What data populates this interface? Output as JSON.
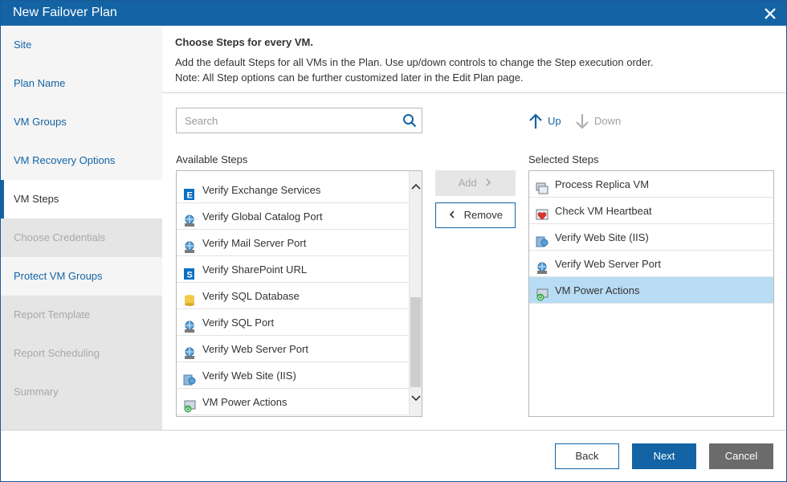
{
  "window": {
    "title": "New Failover Plan"
  },
  "nav": [
    {
      "label": "Site",
      "state": "done"
    },
    {
      "label": "Plan Name",
      "state": "done"
    },
    {
      "label": "VM Groups",
      "state": "done"
    },
    {
      "label": "VM Recovery Options",
      "state": "done"
    },
    {
      "label": "VM Steps",
      "state": "active"
    },
    {
      "label": "Choose Credentials",
      "state": "disabled"
    },
    {
      "label": "Protect VM Groups",
      "state": "done"
    },
    {
      "label": "Report Template",
      "state": "disabled"
    },
    {
      "label": "Report Scheduling",
      "state": "disabled"
    },
    {
      "label": "Summary",
      "state": "disabled"
    }
  ],
  "header": {
    "title": "Choose Steps for every VM.",
    "line1": "Add the default Steps for all VMs in the Plan. Use up/down controls to change the Step execution order.",
    "line2": "Note: All Step options can be further customized later in the Edit Plan page."
  },
  "search": {
    "placeholder": "Search",
    "value": ""
  },
  "available": {
    "label": "Available Steps",
    "items": [
      {
        "label": "Verify Exchange Services",
        "icon": "exchange-icon"
      },
      {
        "label": "Verify Global Catalog Port",
        "icon": "globe-port-icon"
      },
      {
        "label": "Verify Mail Server Port",
        "icon": "globe-port-icon"
      },
      {
        "label": "Verify SharePoint URL",
        "icon": "sharepoint-icon"
      },
      {
        "label": "Verify SQL Database",
        "icon": "database-icon"
      },
      {
        "label": "Verify SQL Port",
        "icon": "globe-port-icon"
      },
      {
        "label": "Verify Web Server Port",
        "icon": "globe-port-icon"
      },
      {
        "label": "Verify Web Site (IIS)",
        "icon": "iis-icon"
      },
      {
        "label": "VM Power Actions",
        "icon": "vm-power-icon"
      }
    ]
  },
  "actions": {
    "add": "Add",
    "remove": "Remove",
    "up": "Up",
    "down": "Down"
  },
  "selected": {
    "label": "Selected Steps",
    "items": [
      {
        "label": "Process Replica VM",
        "icon": "replica-icon"
      },
      {
        "label": "Check VM Heartbeat",
        "icon": "heartbeat-icon"
      },
      {
        "label": "Verify Web Site (IIS)",
        "icon": "iis-icon"
      },
      {
        "label": "Verify Web Server Port",
        "icon": "globe-port-icon"
      },
      {
        "label": "VM Power Actions",
        "icon": "vm-power-icon",
        "selected": true
      }
    ]
  },
  "footer": {
    "back": "Back",
    "next": "Next",
    "cancel": "Cancel"
  },
  "colors": {
    "accent": "#1464a5",
    "selection": "#b8dcf4",
    "sidebar": "#e5e5e5",
    "cancel": "#6b6b6b"
  }
}
